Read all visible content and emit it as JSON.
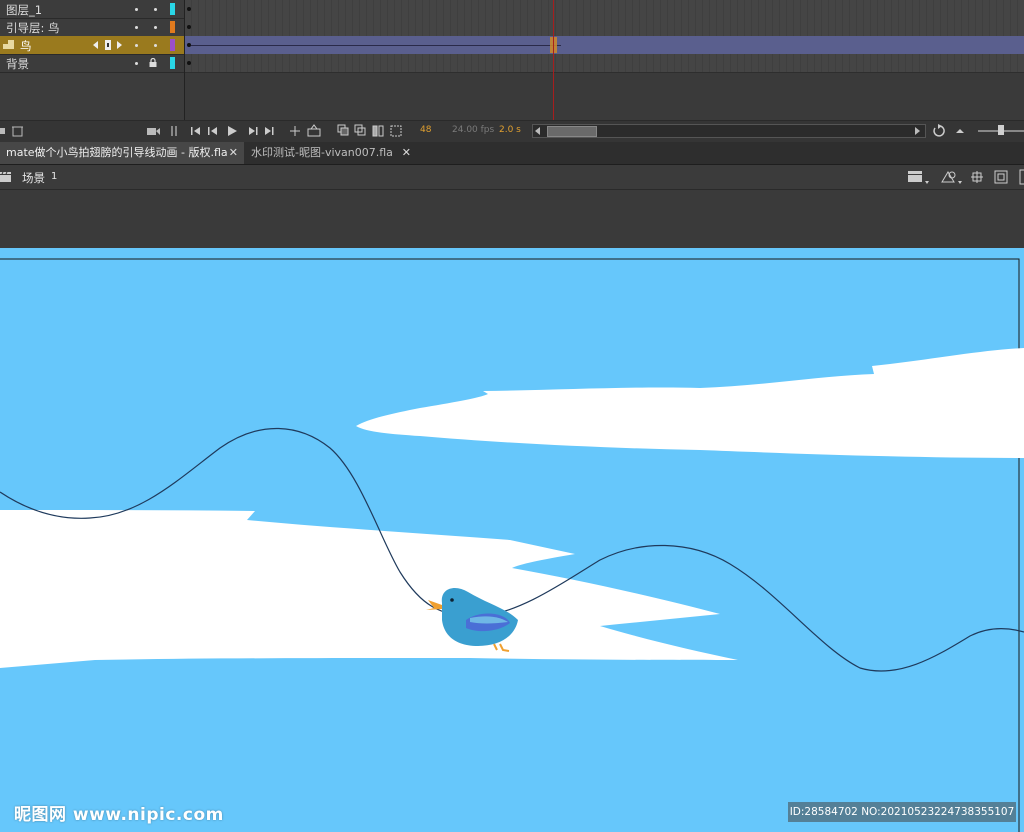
{
  "layers": [
    {
      "name": "图层_1",
      "color": "#29d6e6",
      "selected": false,
      "locked": false
    },
    {
      "name": "引导层: 鸟",
      "color": "#e07a1e",
      "selected": false,
      "locked": false
    },
    {
      "name": "鸟",
      "color": "#9b4fc8",
      "selected": true,
      "locked": false
    },
    {
      "name": "背景",
      "color": "#29d6e6",
      "selected": false,
      "locked": true
    }
  ],
  "timeline": {
    "current_frame": "48",
    "fps": "24.00 fps",
    "elapsed": "2.0 s"
  },
  "tabs": [
    {
      "label": "mate做个小鸟拍翅膀的引导线动画 - 版权.fla",
      "active": true
    },
    {
      "label": "水印测试-昵图-vivan007.fla",
      "active": false
    }
  ],
  "editbar": {
    "scene_label": "场景",
    "scene_number": "1"
  },
  "watermark": {
    "logo": "昵图网 www.nipic.com",
    "id": "ID:28584702 NO:20210523224738355107"
  },
  "colors": {
    "stage": "#66c7fb",
    "cloud": "#ffffff",
    "bird_body": "#3a9fd0",
    "bird_wing": "#4a6fd6",
    "beak": "#f0a030",
    "guide_line": "#1f3a5c",
    "selected_layer": "#9a7a1e",
    "playhead": "#a61e1e"
  }
}
